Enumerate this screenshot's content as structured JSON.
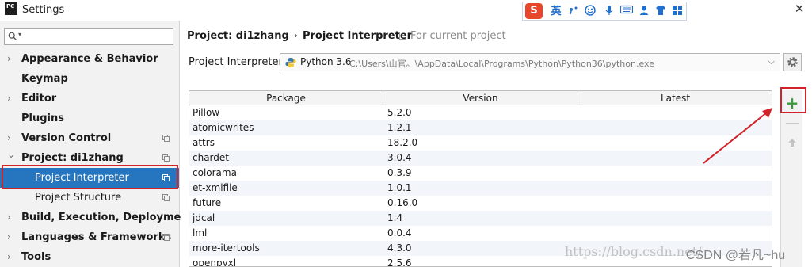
{
  "window": {
    "app_icon_text": "PC",
    "title": "Settings",
    "close_glyph": "✕"
  },
  "ime_toolbar": {
    "logo": "S",
    "mode": "英",
    "items": [
      "punctuation-icon",
      "emoji-icon",
      "microphone-icon",
      "keyboard-icon",
      "user-icon",
      "skin-icon",
      "grid-icon"
    ]
  },
  "sidebar": {
    "search_placeholder": "",
    "items": [
      {
        "label": "Appearance & Behavior",
        "arrow": "›",
        "bold": true,
        "copy": false
      },
      {
        "label": "Keymap",
        "arrow": "",
        "bold": true,
        "copy": false
      },
      {
        "label": "Editor",
        "arrow": "›",
        "bold": true,
        "copy": false
      },
      {
        "label": "Plugins",
        "arrow": "",
        "bold": true,
        "copy": false
      },
      {
        "label": "Version Control",
        "arrow": "›",
        "bold": true,
        "copy": true
      },
      {
        "label": "Project: di1zhang",
        "arrow": "⌄",
        "bold": true,
        "copy": true
      },
      {
        "label": "Project Interpreter",
        "arrow": "",
        "bold": false,
        "copy": true,
        "selected": true
      },
      {
        "label": "Project Structure",
        "arrow": "",
        "bold": false,
        "copy": true
      },
      {
        "label": "Build, Execution, Deployment",
        "arrow": "›",
        "bold": true,
        "copy": false
      },
      {
        "label": "Languages & Frameworks",
        "arrow": "›",
        "bold": true,
        "copy": true
      },
      {
        "label": "Tools",
        "arrow": "›",
        "bold": true,
        "copy": false
      }
    ]
  },
  "main": {
    "breadcrumb": [
      "Project: di1zhang",
      "Project Interpreter"
    ],
    "breadcrumb_sep": "›",
    "for_current_project": "For current project",
    "interpreter_label": "Project Interpreter:",
    "interpreter_name": "Python 3.6",
    "interpreter_path": "C:\\Users\\山官。\\AppData\\Local\\Programs\\Python\\Python36\\python.exe",
    "columns": [
      "Package",
      "Version",
      "Latest"
    ],
    "packages": [
      {
        "name": "Pillow",
        "version": "5.2.0",
        "latest": ""
      },
      {
        "name": "atomicwrites",
        "version": "1.2.1",
        "latest": ""
      },
      {
        "name": "attrs",
        "version": "18.2.0",
        "latest": ""
      },
      {
        "name": "chardet",
        "version": "3.0.4",
        "latest": ""
      },
      {
        "name": "colorama",
        "version": "0.3.9",
        "latest": ""
      },
      {
        "name": "et-xmlfile",
        "version": "1.0.1",
        "latest": ""
      },
      {
        "name": "future",
        "version": "0.16.0",
        "latest": ""
      },
      {
        "name": "jdcal",
        "version": "1.4",
        "latest": ""
      },
      {
        "name": "lml",
        "version": "0.0.4",
        "latest": ""
      },
      {
        "name": "more-itertools",
        "version": "4.3.0",
        "latest": ""
      },
      {
        "name": "openpyxl",
        "version": "2.5.6",
        "latest": ""
      }
    ],
    "tools": {
      "add_glyph": "+",
      "remove_glyph": "—"
    }
  },
  "watermark": {
    "url_text": "https://blog.csdn.net/",
    "csdn_text": "CSDN @若凡~hu"
  },
  "colors": {
    "selection": "#2675bf",
    "highlight_outline": "#d1232a",
    "add_green": "#3a9a3a"
  }
}
